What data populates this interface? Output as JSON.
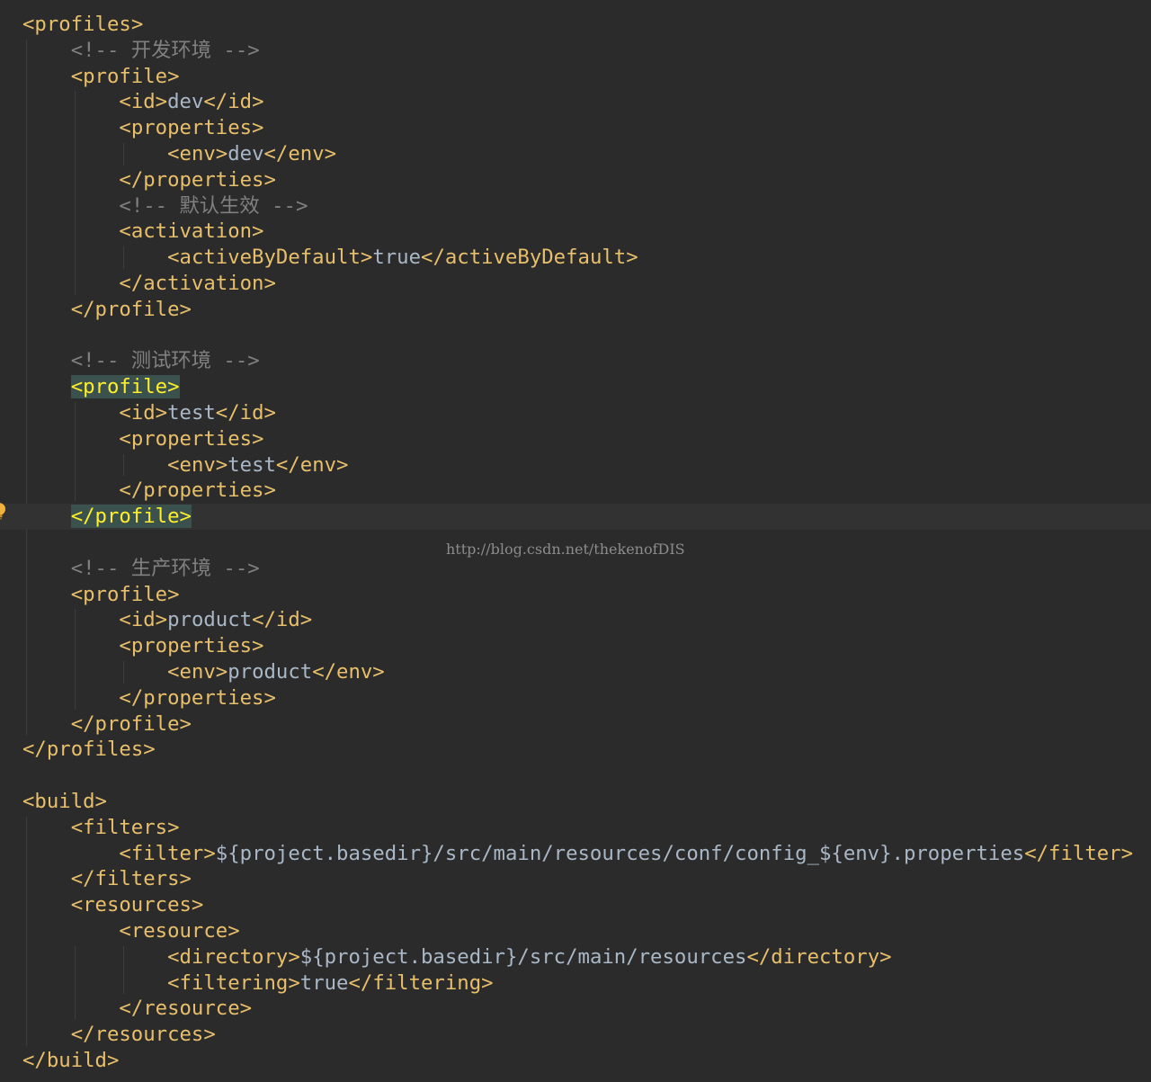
{
  "editor": {
    "theme_colors": {
      "background": "#2b2b2b",
      "tag": "#e8bf6a",
      "text": "#a9b7c6",
      "comment": "#808080",
      "match_highlight": "#3b514d",
      "match_text": "#ffef28"
    },
    "current_line": 20,
    "gutter_icon": "lightbulb-icon",
    "watermark": "http://blog.csdn.net/thekenofDIS",
    "lines": [
      [
        {
          "t": "tag",
          "v": "<profiles>"
        }
      ],
      [
        {
          "t": "cmt",
          "v": "<!-- 开发环境 -->"
        }
      ],
      [
        {
          "t": "tag",
          "v": "<profile>"
        }
      ],
      [
        {
          "t": "tag",
          "v": "<id>"
        },
        {
          "t": "txt",
          "v": "dev"
        },
        {
          "t": "tag",
          "v": "</id>"
        }
      ],
      [
        {
          "t": "tag",
          "v": "<properties>"
        }
      ],
      [
        {
          "t": "tag",
          "v": "<env>"
        },
        {
          "t": "txt",
          "v": "dev"
        },
        {
          "t": "tag",
          "v": "</env>"
        }
      ],
      [
        {
          "t": "tag",
          "v": "</properties>"
        }
      ],
      [
        {
          "t": "cmt",
          "v": "<!-- 默认生效 -->"
        }
      ],
      [
        {
          "t": "tag",
          "v": "<activation>"
        }
      ],
      [
        {
          "t": "tag",
          "v": "<activeByDefault>"
        },
        {
          "t": "txt",
          "v": "true"
        },
        {
          "t": "tag",
          "v": "</activeByDefault>"
        }
      ],
      [
        {
          "t": "tag",
          "v": "</activation>"
        }
      ],
      [
        {
          "t": "tag",
          "v": "</profile>"
        }
      ],
      [],
      [
        {
          "t": "cmt",
          "v": "<!-- 测试环境 -->"
        }
      ],
      [
        {
          "t": "match",
          "v": "<profile>"
        }
      ],
      [
        {
          "t": "tag",
          "v": "<id>"
        },
        {
          "t": "txt",
          "v": "test"
        },
        {
          "t": "tag",
          "v": "</id>"
        }
      ],
      [
        {
          "t": "tag",
          "v": "<properties>"
        }
      ],
      [
        {
          "t": "tag",
          "v": "<env>"
        },
        {
          "t": "txt",
          "v": "test"
        },
        {
          "t": "tag",
          "v": "</env>"
        }
      ],
      [
        {
          "t": "tag",
          "v": "</properties>"
        }
      ],
      [
        {
          "t": "match",
          "v": "</profile>"
        }
      ],
      [],
      [
        {
          "t": "cmt",
          "v": "<!-- 生产环境 -->"
        }
      ],
      [
        {
          "t": "tag",
          "v": "<profile>"
        }
      ],
      [
        {
          "t": "tag",
          "v": "<id>"
        },
        {
          "t": "txt",
          "v": "product"
        },
        {
          "t": "tag",
          "v": "</id>"
        }
      ],
      [
        {
          "t": "tag",
          "v": "<properties>"
        }
      ],
      [
        {
          "t": "tag",
          "v": "<env>"
        },
        {
          "t": "txt",
          "v": "product"
        },
        {
          "t": "tag",
          "v": "</env>"
        }
      ],
      [
        {
          "t": "tag",
          "v": "</properties>"
        }
      ],
      [
        {
          "t": "tag",
          "v": "</profile>"
        }
      ],
      [
        {
          "t": "tag",
          "v": "</profiles>"
        }
      ],
      [],
      [
        {
          "t": "tag",
          "v": "<build>"
        }
      ],
      [
        {
          "t": "tag",
          "v": "<filters>"
        }
      ],
      [
        {
          "t": "tag",
          "v": "<filter>"
        },
        {
          "t": "txt",
          "v": "${project.basedir}/src/main/resources/conf/config_${env}.properties"
        },
        {
          "t": "tag",
          "v": "</filter>"
        }
      ],
      [
        {
          "t": "tag",
          "v": "</filters>"
        }
      ],
      [
        {
          "t": "tag",
          "v": "<resources>"
        }
      ],
      [
        {
          "t": "tag",
          "v": "<resource>"
        }
      ],
      [
        {
          "t": "tag",
          "v": "<directory>"
        },
        {
          "t": "txt",
          "v": "${project.basedir}/src/main/resources"
        },
        {
          "t": "tag",
          "v": "</directory>"
        }
      ],
      [
        {
          "t": "tag",
          "v": "<filtering>"
        },
        {
          "t": "txt",
          "v": "true"
        },
        {
          "t": "tag",
          "v": "</filtering>"
        }
      ],
      [
        {
          "t": "tag",
          "v": "</resource>"
        }
      ],
      [
        {
          "t": "tag",
          "v": "</resources>"
        }
      ],
      [
        {
          "t": "tag",
          "v": "</build>"
        }
      ]
    ]
  }
}
